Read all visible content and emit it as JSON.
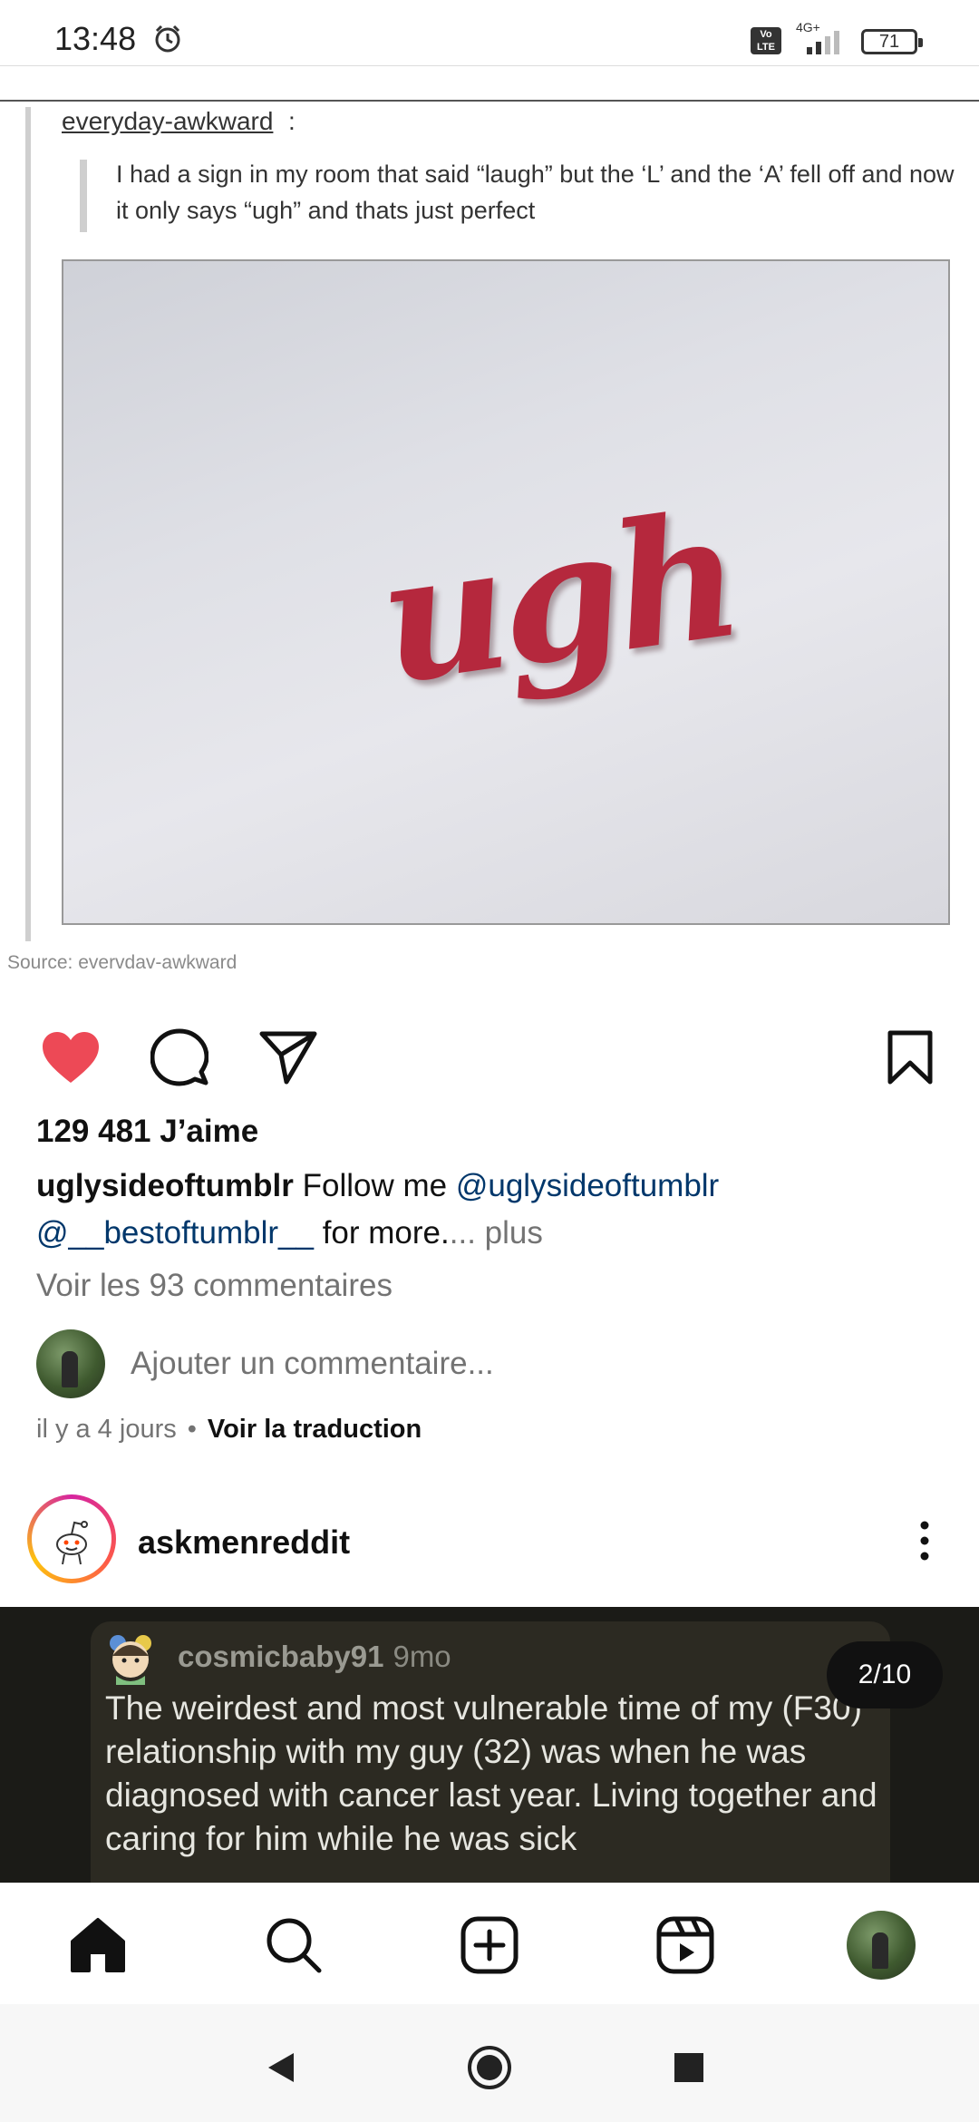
{
  "status_bar": {
    "time": "13:48",
    "volte": "Vo LTE",
    "network": "4G+",
    "battery": "71"
  },
  "post": {
    "tumblr_username": "everyday-awkward",
    "tumblr_colon": ":",
    "quote": "I had a sign in my room that said “laugh” but the ‘L’ and the ‘A’ fell off and now it only says “ugh” and thats just perfect",
    "sign_text": "ugh",
    "source": "Source: evervdav-awkward",
    "likes": "129 481 J’aime",
    "caption_user": "uglysideoftumblr",
    "caption_text": " Follow me ",
    "caption_mention1": "@uglysideoftumblr",
    "caption_mention2": "@__bestoftumblr__",
    "caption_tail": " for more.",
    "caption_more": "... plus",
    "view_comments": "Voir les 93 commentaires",
    "add_comment_placeholder": "Ajouter un commentaire...",
    "time_ago": "il y a 4 jours",
    "separator": "•",
    "translate": "Voir la traduction"
  },
  "next_post": {
    "username": "askmenreddit",
    "reddit_user": "cosmicbaby91",
    "reddit_age": "9mo",
    "reddit_text": "The weirdest and most vulnerable time of my (F30) relationship with my guy (32) was when he was diagnosed with cancer last year. Living together and caring for him while he was sick",
    "counter": "2/10"
  },
  "colors": {
    "like_red": "#ed4956",
    "mention_blue": "#00376b",
    "secondary_text": "#737373"
  },
  "icons": {
    "like": "heart-filled-icon",
    "comment": "comment-bubble-icon",
    "share": "paper-plane-icon",
    "save": "bookmark-icon",
    "home": "home-icon",
    "search": "search-icon",
    "create": "plus-square-icon",
    "reels": "reels-icon",
    "back": "triangle-back-icon",
    "system_home": "circle-home-icon",
    "recents": "square-recents-icon"
  }
}
